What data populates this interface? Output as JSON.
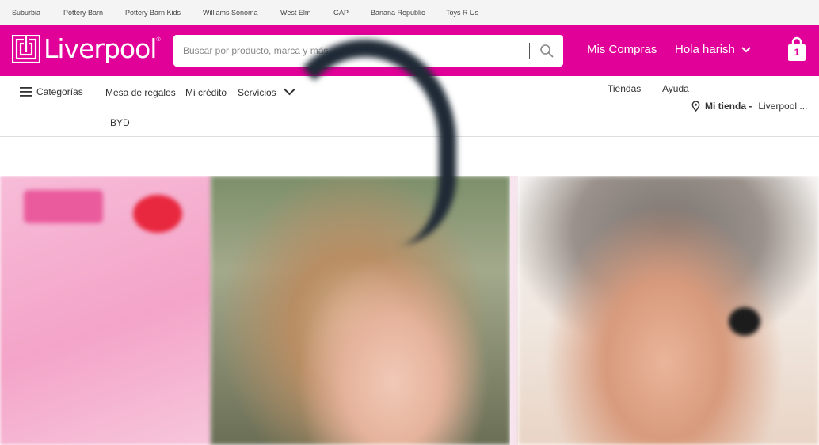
{
  "top_links": [
    "Suburbia",
    "Pottery Barn",
    "Pottery Barn Kids",
    "Williams Sonoma",
    "West Elm",
    "GAP",
    "Banana Republic",
    "Toys R Us"
  ],
  "header": {
    "logo_text": "Liverpool",
    "logo_reg": "®",
    "search_placeholder": "Buscar por producto, marca y más...",
    "mis_compras": "Mis Compras",
    "greeting": "Hola harish",
    "cart_count": "1",
    "brand_color": "#e10098"
  },
  "nav": {
    "categorias": "Categorías",
    "mesa_regalos": "Mesa de regalos",
    "mi_credito": "Mi crédito",
    "servicios": "Servicios",
    "byd": "BYD",
    "tiendas": "Tiendas",
    "ayuda": "Ayuda",
    "mi_tienda_label": "Mi tienda -",
    "mi_tienda_value": "Liverpool ..."
  }
}
